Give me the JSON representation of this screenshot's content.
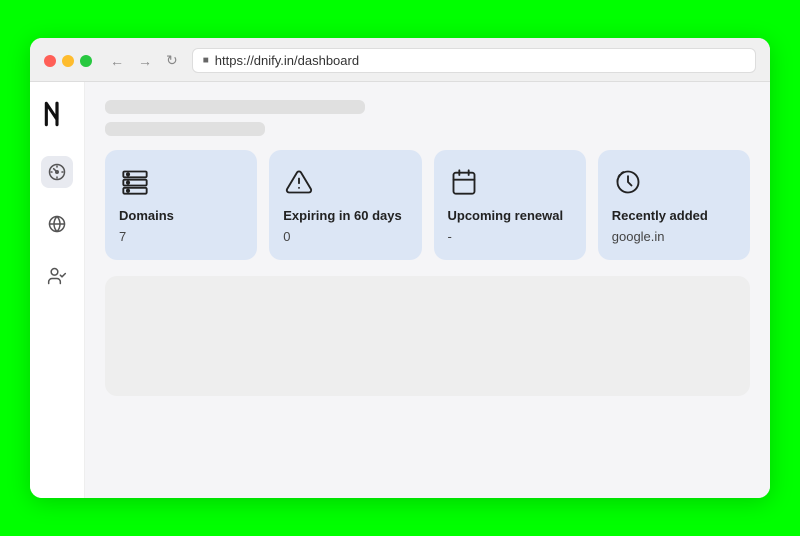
{
  "browser": {
    "url": "https://dnify.in/dashboard",
    "back_label": "←",
    "forward_label": "→",
    "refresh_label": "↻"
  },
  "traffic_lights": {
    "red": "red",
    "yellow": "yellow",
    "green": "green"
  },
  "sidebar": {
    "logo_alt": "dnify-logo",
    "items": [
      {
        "name": "dashboard",
        "icon": "speedometer"
      },
      {
        "name": "domains",
        "icon": "globe"
      },
      {
        "name": "users",
        "icon": "user-check"
      }
    ]
  },
  "stats": [
    {
      "id": "domains",
      "label": "Domains",
      "value": "7",
      "icon": "server"
    },
    {
      "id": "expiring",
      "label": "Expiring in 60 days",
      "value": "0",
      "icon": "alert-triangle"
    },
    {
      "id": "upcoming-renewal",
      "label": "Upcoming renewal",
      "value": "-",
      "icon": "calendar"
    },
    {
      "id": "recently-added",
      "label": "Recently added",
      "value": "google.in",
      "icon": "clock"
    }
  ]
}
